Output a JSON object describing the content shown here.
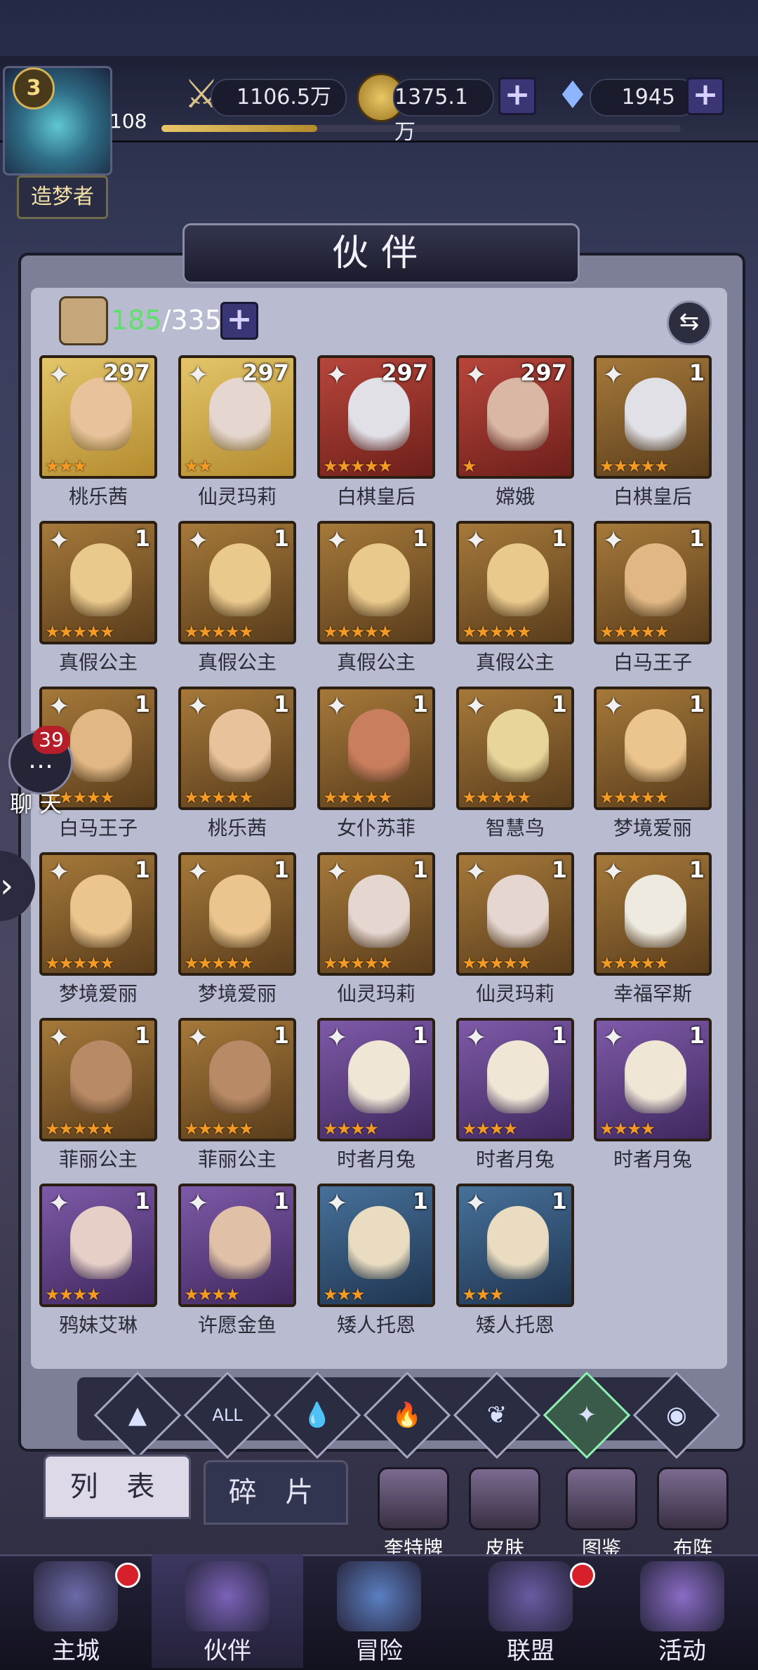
{
  "player": {
    "level": "3",
    "exp_value": "108",
    "role": "造梦者",
    "exp_fraction": 0.3
  },
  "resources": {
    "power": "1106.5万",
    "gold": "1375.1万",
    "gems": "1945"
  },
  "screen_title": "伙伴",
  "partner_count": {
    "current": "185",
    "max": "/335"
  },
  "cards": [
    {
      "name": "桃乐茜",
      "level": "297",
      "stars": "★★★",
      "bg": "gold",
      "face": "#e7c29a"
    },
    {
      "name": "仙灵玛莉",
      "level": "297",
      "stars": "★★",
      "bg": "gold",
      "face": "#e6d6d0"
    },
    {
      "name": "白棋皇后",
      "level": "297",
      "stars": "★★★★★",
      "bg": "red",
      "face": "#e0e0e6"
    },
    {
      "name": "嫦娥",
      "level": "297",
      "stars": "★",
      "bg": "red",
      "face": "#d9b7a4"
    },
    {
      "name": "白棋皇后",
      "level": "1",
      "stars": "★★★★★",
      "bg": "brown",
      "face": "#e0e0e6"
    },
    {
      "name": "真假公主",
      "level": "1",
      "stars": "★★★★★",
      "bg": "brown",
      "face": "#e9c98c"
    },
    {
      "name": "真假公主",
      "level": "1",
      "stars": "★★★★★",
      "bg": "brown",
      "face": "#e9c98c"
    },
    {
      "name": "真假公主",
      "level": "1",
      "stars": "★★★★★",
      "bg": "brown",
      "face": "#e9c98c"
    },
    {
      "name": "真假公主",
      "level": "1",
      "stars": "★★★★★",
      "bg": "brown",
      "face": "#e9c98c"
    },
    {
      "name": "白马王子",
      "level": "1",
      "stars": "★★★★★",
      "bg": "brown",
      "face": "#e1b885"
    },
    {
      "name": "白马王子",
      "level": "1",
      "stars": "★★★★★",
      "bg": "brown",
      "face": "#e1b885"
    },
    {
      "name": "桃乐茜",
      "level": "1",
      "stars": "★★★★★",
      "bg": "brown",
      "face": "#e7c29a"
    },
    {
      "name": "女仆苏菲",
      "level": "1",
      "stars": "★★★★★",
      "bg": "brown",
      "face": "#c97e5e"
    },
    {
      "name": "智慧鸟",
      "level": "1",
      "stars": "★★★★★",
      "bg": "brown",
      "face": "#e8d59a"
    },
    {
      "name": "梦境爱丽",
      "level": "1",
      "stars": "★★★★★",
      "bg": "brown",
      "face": "#ebc58d"
    },
    {
      "name": "梦境爱丽",
      "level": "1",
      "stars": "★★★★★",
      "bg": "brown",
      "face": "#ebc58d"
    },
    {
      "name": "梦境爱丽",
      "level": "1",
      "stars": "★★★★★",
      "bg": "brown",
      "face": "#ebc58d"
    },
    {
      "name": "仙灵玛莉",
      "level": "1",
      "stars": "★★★★★",
      "bg": "brown",
      "face": "#e6d6d0"
    },
    {
      "name": "仙灵玛莉",
      "level": "1",
      "stars": "★★★★★",
      "bg": "brown",
      "face": "#e6d6d0"
    },
    {
      "name": "幸福罕斯",
      "level": "1",
      "stars": "★★★★★",
      "bg": "brown",
      "face": "#eeeadf"
    },
    {
      "name": "菲丽公主",
      "level": "1",
      "stars": "★★★★★",
      "bg": "brown",
      "face": "#b98a66"
    },
    {
      "name": "菲丽公主",
      "level": "1",
      "stars": "★★★★★",
      "bg": "brown",
      "face": "#b98a66"
    },
    {
      "name": "时者月兔",
      "level": "1",
      "stars": "★★★★",
      "bg": "purple",
      "face": "#efe6d6"
    },
    {
      "name": "时者月兔",
      "level": "1",
      "stars": "★★★★",
      "bg": "purple",
      "face": "#efe6d6"
    },
    {
      "name": "时者月兔",
      "level": "1",
      "stars": "★★★★",
      "bg": "purple",
      "face": "#efe6d6"
    },
    {
      "name": "鸦妹艾琳",
      "level": "1",
      "stars": "★★★★",
      "bg": "purple",
      "face": "#e6cfc7"
    },
    {
      "name": "许愿金鱼",
      "level": "1",
      "stars": "★★★★",
      "bg": "purple",
      "face": "#e0c0a6"
    },
    {
      "name": "矮人托恩",
      "level": "1",
      "stars": "★★★",
      "bg": "blue",
      "face": "#e9dcc0"
    },
    {
      "name": "矮人托恩",
      "level": "1",
      "stars": "★★★",
      "bg": "blue",
      "face": "#e9dcc0"
    }
  ],
  "chat": {
    "badge": "39",
    "label": "聊 天"
  },
  "factions": [
    "▲",
    "ALL",
    "💧",
    "🔥",
    "❦",
    "✦",
    "◉"
  ],
  "tabs": {
    "list": "列 表",
    "fragments": "碎 片"
  },
  "features": [
    "奎特牌",
    "皮肤",
    "图鉴",
    "布阵"
  ],
  "nav": [
    "主城",
    "伙伴",
    "冒险",
    "联盟",
    "活动"
  ],
  "colors": {
    "gold": "#c9a43c",
    "red": "#8e2a22",
    "brown": "#7c5a2c",
    "purple": "#5c3d7e",
    "blue": "#2f4c6e"
  }
}
